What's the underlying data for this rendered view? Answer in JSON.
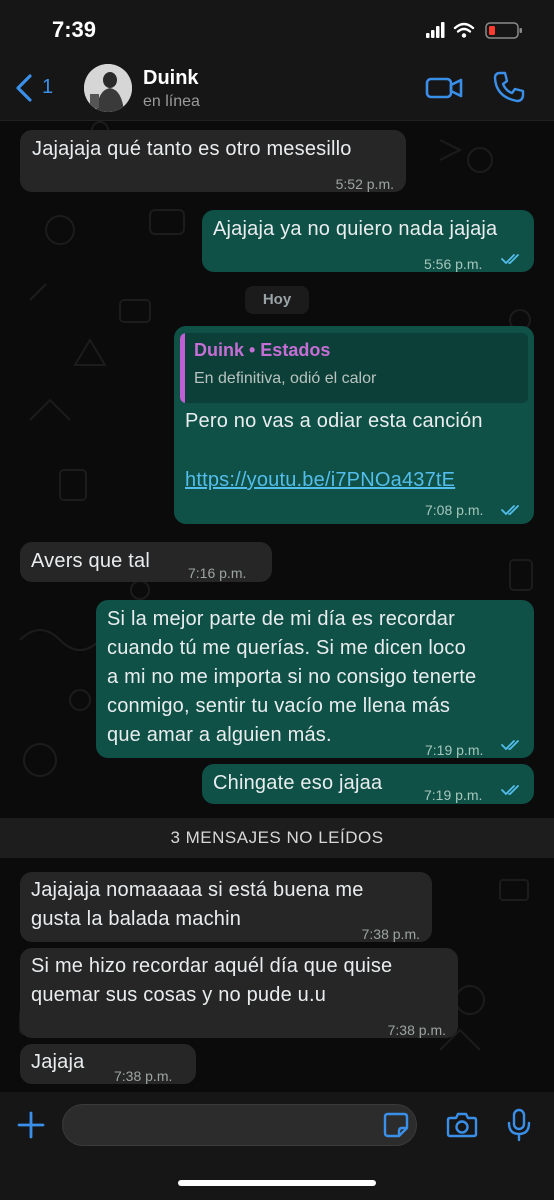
{
  "status_bar": {
    "time": "7:39"
  },
  "header": {
    "back_count": "1",
    "contact_name": "Duink",
    "contact_status": "en línea"
  },
  "messages": [
    {
      "direction": "in",
      "text": "Jajajaja qué tanto es otro mesesillo",
      "time": "5:52 p.m."
    },
    {
      "direction": "out",
      "text": "Ajajaja ya no quiero nada jajaja",
      "time": "5:56 p.m.",
      "read": true
    },
    {
      "direction": "date",
      "text": "Hoy"
    },
    {
      "direction": "out",
      "quote_author": "Duink • Estados",
      "quote_text": "En definitiva, odió el calor",
      "text": "Pero no vas a odiar esta canción",
      "link": "https://youtu.be/i7PNOa437tE",
      "time": "7:08 p.m.",
      "read": true
    },
    {
      "direction": "in",
      "text": "Avers que tal",
      "time": "7:16 p.m."
    },
    {
      "direction": "out",
      "text": "Si la mejor parte de mi día es recordar\ncuando tú me querías. Si me dicen loco\na mi no me importa si no consigo tenerte\nconmigo, sentir tu vacío me llena más\nque amar a alguien más.",
      "time": "7:19 p.m.",
      "read": true
    },
    {
      "direction": "out",
      "text": "Chingate eso jajaa",
      "time": "7:19 p.m.",
      "read": true
    },
    {
      "direction": "banner",
      "text": "3 MENSAJES NO LEÍDOS"
    },
    {
      "direction": "in",
      "text": "Jajajaja nomaaaaa si está buena me\ngusta la balada machin",
      "time": "7:38 p.m."
    },
    {
      "direction": "in",
      "text": "Si me hizo recordar aquél día que quise\nquemar sus cosas y no pude u.u",
      "time": "7:38 p.m."
    },
    {
      "direction": "in",
      "text": "Jajaja",
      "time": "7:38 p.m."
    }
  ],
  "colors": {
    "incoming_bubble": "#262626",
    "outgoing_bubble": "#0f5146",
    "accent_blue": "#3a8fe8",
    "quote_purple": "#c46ed6",
    "link": "#53bdeb",
    "read_ticks": "#53bdeb"
  },
  "icons": [
    "back-chevron-icon",
    "video-call-icon",
    "phone-icon",
    "plus-icon",
    "sticker-icon",
    "camera-icon",
    "mic-icon",
    "read-ticks-icon"
  ]
}
